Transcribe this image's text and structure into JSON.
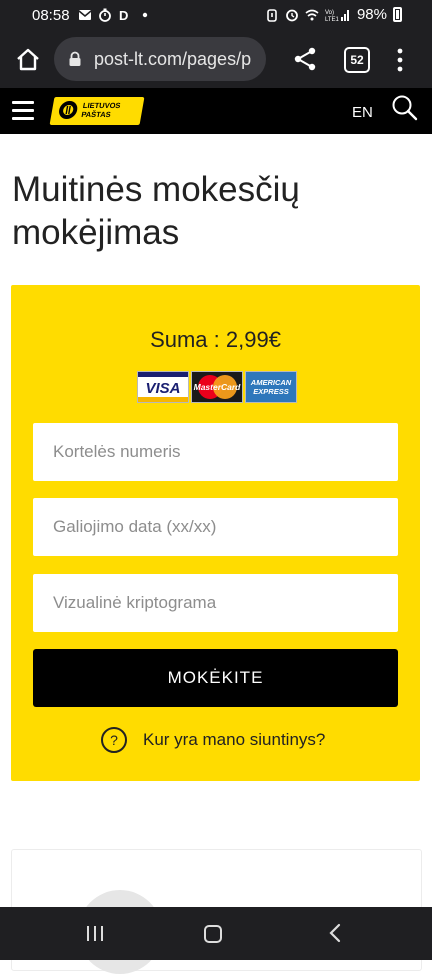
{
  "status_bar": {
    "time": "08:58",
    "left_icons": [
      "gmail-icon",
      "timer-icon",
      "d-app-icon",
      "dot-icon"
    ],
    "right_icons": [
      "alarm-icon",
      "clock-icon",
      "wifi-icon",
      "volte-signal-icon"
    ],
    "battery_percent": "98%"
  },
  "browser": {
    "url": "post-lt.com/pages/p",
    "tab_count": "52"
  },
  "site_header": {
    "logo_line1": "LIETUVOS",
    "logo_line2": "PAŠTAS",
    "language": "EN"
  },
  "page": {
    "title": "Muitinės mokesčių mokėjimas"
  },
  "payment": {
    "amount": "Suma : 2,99€",
    "cards": {
      "visa": "VISA",
      "mastercard": "MasterCard",
      "amex_line1": "AMERICAN",
      "amex_line2": "EXPRESS"
    },
    "card_number_placeholder": "Kortelės numeris",
    "expiry_placeholder": "Galiojimo data (xx/xx)",
    "cvv_placeholder": "Vizualinė kriptograma",
    "pay_button": "MOKĖKITE",
    "help_symbol": "?",
    "help_link": "Kur yra mano siuntinys?"
  },
  "colors": {
    "brand_yellow": "#ffdc00",
    "header_black": "#000000",
    "system_bar": "#1f1f22"
  }
}
